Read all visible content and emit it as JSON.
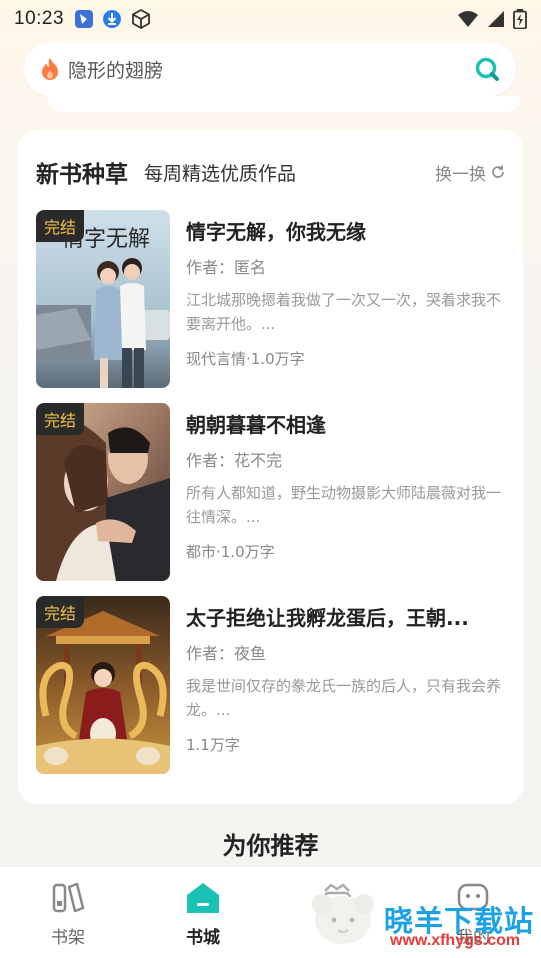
{
  "status_bar": {
    "time": "10:23"
  },
  "search": {
    "query": "隐形的翅膀"
  },
  "section": {
    "title": "新书种草",
    "subtitle": "每周精选优质作品",
    "refresh_label": "换一换"
  },
  "books": [
    {
      "badge": "完结",
      "cover_text": "情字无解",
      "title": "情字无解，你我无缘",
      "author": "作者：匿名",
      "desc": "江北城那晚摁着我做了一次又一次，哭着求我不要离开他。...",
      "meta": "现代言情·1.0万字"
    },
    {
      "badge": "完结",
      "title": "朝朝暮暮不相逢",
      "author": "作者：花不完",
      "desc": "所有人都知道，野生动物摄影大师陆晨薇对我一往情深。...",
      "meta": "都市·1.0万字"
    },
    {
      "badge": "完结",
      "title": "太子拒绝让我孵龙蛋后，王朝...",
      "author": "作者：夜鱼",
      "desc": "我是世间仅存的豢龙氏一族的后人，只有我会养龙。...",
      "meta": "1.1万字"
    }
  ],
  "recommend_title": "为你推荐",
  "nav": {
    "shelf": "书架",
    "store": "书城",
    "mine": "我的"
  },
  "watermark": {
    "title": "晓羊下载站",
    "url": "www.xfhygs.com"
  },
  "colors": {
    "accent": "#19c2b5",
    "badge_text": "#f4c24a",
    "flame": "#ff7a3d"
  }
}
